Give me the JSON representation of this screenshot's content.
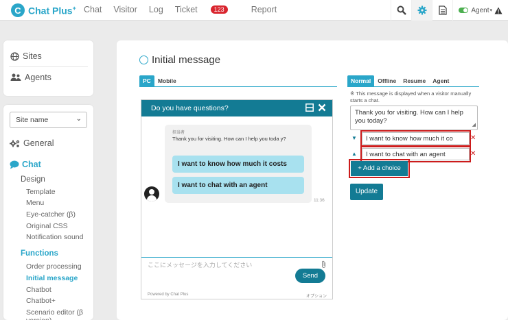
{
  "app": {
    "logo_text": "Chat Plus",
    "logo_sup": "+"
  },
  "nav": {
    "items": [
      {
        "label": "Chat"
      },
      {
        "label": "Visitor"
      },
      {
        "label": "Log"
      },
      {
        "label": "Ticket",
        "badge": "123"
      },
      {
        "label": "Report"
      }
    ]
  },
  "topbar": {
    "agent_label": "Agent",
    "icons": [
      "search-icon",
      "gear-icon",
      "document-icon",
      "warning-icon"
    ]
  },
  "sidebar": {
    "sites": "Sites",
    "agents": "Agents",
    "site_select": "Site name",
    "general": "General",
    "chat": "Chat",
    "design": "Design",
    "design_items": [
      "Template",
      "Menu",
      "Eye-catcher (β)",
      "Original CSS",
      "Notification sound"
    ],
    "functions": "Functions",
    "function_items": [
      "Order processing",
      "Initial message",
      "Chatbot",
      "Chatbot+",
      "Scenario editor (β version)"
    ],
    "active_item": "Initial message"
  },
  "main": {
    "title": "Initial message",
    "device_tabs": [
      "PC",
      "Mobile"
    ],
    "message_tabs": [
      "Normal",
      "Offline",
      "Resume",
      "Agent"
    ],
    "widget": {
      "header": "Do you have questions?",
      "sender": "担当者",
      "message": "Thank you for visiting. How can I help you toda y?",
      "choices": [
        "I want to know how much it costs",
        "I want to chat with an agent"
      ],
      "time": "11:36",
      "input_placeholder": "ここにメッセージを入力してください",
      "send_label": "Send",
      "powered_by": "Powered by Chat Plus",
      "option_label": "オプション"
    },
    "settings": {
      "note": "※ This message is displayed when a visitor manually starts a chat.",
      "message_text": "Thank you for visiting. How can I help you today?",
      "choice_fields": [
        "I want to know how much it co",
        "I want to chat with an agent"
      ],
      "add_choice_label": "+ Add a choice",
      "update_label": "Update"
    }
  },
  "colors": {
    "accent": "#2aa6c9",
    "dark_teal": "#137b94",
    "choice_bg": "#a8e1ef",
    "highlight": "#cc1b1b",
    "badge": "#d9262f"
  }
}
